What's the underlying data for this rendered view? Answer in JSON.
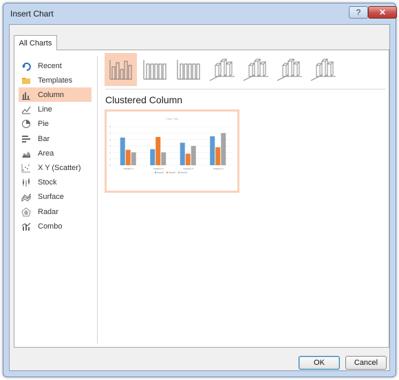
{
  "window": {
    "title": "Insert Chart",
    "help_label": "?",
    "close_label": "✕"
  },
  "tab": {
    "label": "All Charts"
  },
  "chart_types": [
    {
      "label": "Recent",
      "icon": "recent-icon"
    },
    {
      "label": "Templates",
      "icon": "folder-icon"
    },
    {
      "label": "Column",
      "icon": "column-chart-icon",
      "selected": true
    },
    {
      "label": "Line",
      "icon": "line-chart-icon"
    },
    {
      "label": "Pie",
      "icon": "pie-chart-icon"
    },
    {
      "label": "Bar",
      "icon": "bar-chart-icon"
    },
    {
      "label": "Area",
      "icon": "area-chart-icon"
    },
    {
      "label": "X Y (Scatter)",
      "icon": "scatter-chart-icon"
    },
    {
      "label": "Stock",
      "icon": "stock-chart-icon"
    },
    {
      "label": "Surface",
      "icon": "surface-chart-icon"
    },
    {
      "label": "Radar",
      "icon": "radar-chart-icon"
    },
    {
      "label": "Combo",
      "icon": "combo-chart-icon"
    }
  ],
  "subtype_heading": "Clustered Column",
  "subtypes": [
    "clustered-column-icon",
    "stacked-column-icon",
    "100-stacked-column-icon",
    "3d-clustered-column-icon",
    "3d-stacked-column-icon",
    "3d-100-stacked-column-icon",
    "3d-column-icon"
  ],
  "preview": {
    "title": "Chart Title",
    "categories": [
      "Category 1",
      "Category 2",
      "Category 3",
      "Category 4"
    ],
    "series": [
      {
        "name": "Series1",
        "values": [
          4.3,
          2.5,
          3.5,
          4.5
        ]
      },
      {
        "name": "Series2",
        "values": [
          2.4,
          4.4,
          1.8,
          2.8
        ]
      },
      {
        "name": "Series3",
        "values": [
          2,
          2,
          3,
          5
        ]
      }
    ],
    "y_ticks": [
      "0",
      "1",
      "2",
      "3",
      "4",
      "5",
      "6"
    ],
    "colors": [
      "#5b9bd5",
      "#ed7d31",
      "#a5a5a5"
    ]
  },
  "buttons": {
    "ok": "OK",
    "cancel": "Cancel"
  }
}
